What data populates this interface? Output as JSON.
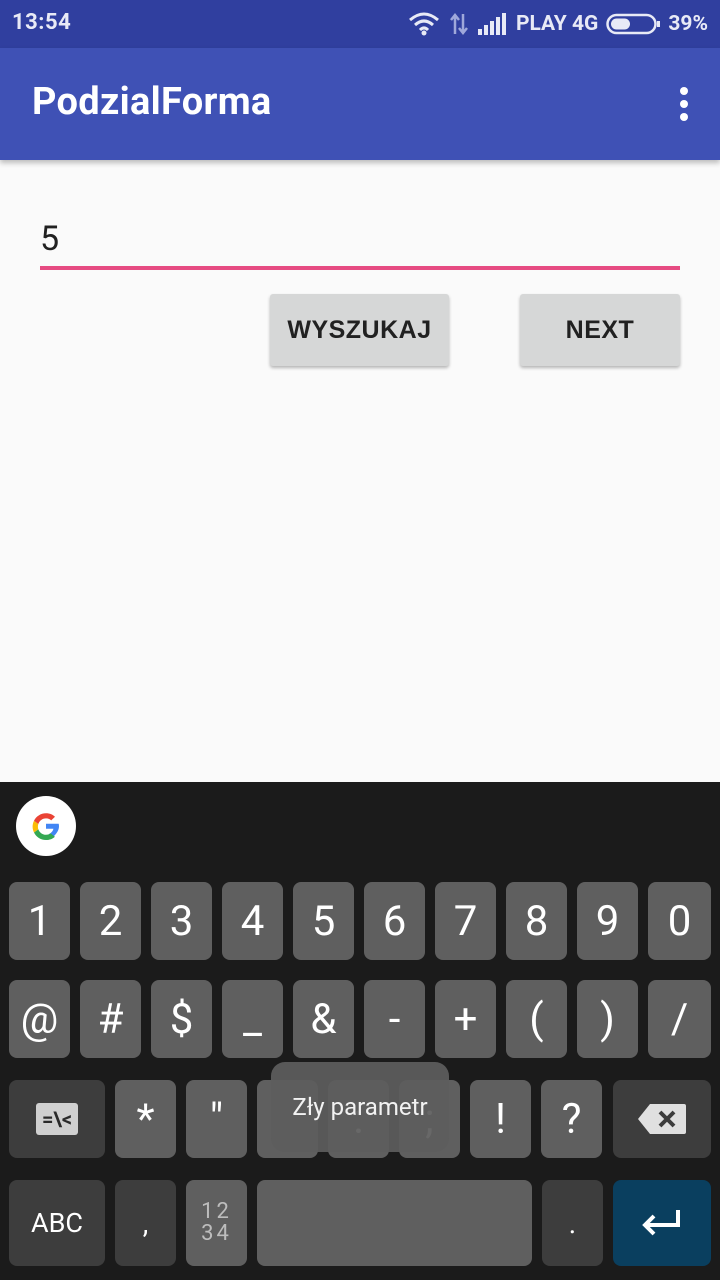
{
  "status_bar": {
    "time": "13:54",
    "carrier": "PLAY 4G",
    "battery_percent": "39%"
  },
  "app_bar": {
    "title": "PodzialForma"
  },
  "form": {
    "input_value": "5",
    "search_button_label": "WYSZUKAJ",
    "next_button_label": "NEXT"
  },
  "keyboard": {
    "row1": [
      "1",
      "2",
      "3",
      "4",
      "5",
      "6",
      "7",
      "8",
      "9",
      "0"
    ],
    "row2": [
      "@",
      "#",
      "$",
      "_",
      "&",
      "-",
      "+",
      "(",
      ")",
      "/"
    ],
    "row3": [
      "*",
      "\"",
      ":",
      ";",
      "!",
      "?"
    ],
    "row3_left_label": "=\\<",
    "abc_label": "ABC",
    "comma_label": ",",
    "nums_label_top": "12",
    "nums_label_bottom": "34",
    "period_label": "."
  },
  "toast": {
    "message": "Zły parametr"
  },
  "colors": {
    "status_bar": "#303f9f",
    "app_bar": "#3f51b5",
    "input_underline": "#e64b82",
    "enter_key": "#0a3f5f"
  }
}
